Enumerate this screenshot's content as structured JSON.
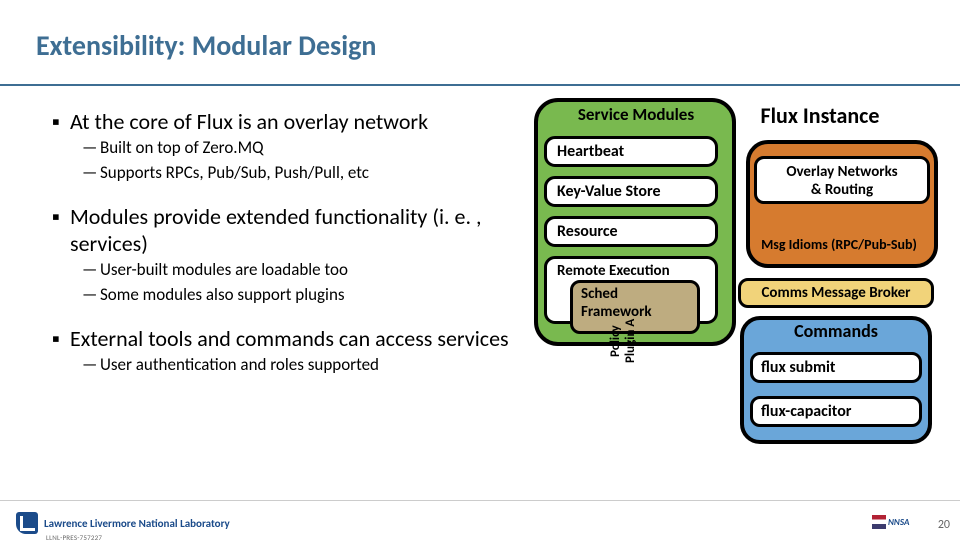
{
  "title": "Extensibility: Modular Design",
  "bullets": {
    "b1": {
      "text": "At the core of Flux is an overlay network",
      "subs": [
        "Built on top of Zero.MQ",
        "Supports RPCs, Pub/Sub, Push/Pull, etc"
      ]
    },
    "b2": {
      "text": "Modules provide extended functionality (i. e. , services)",
      "subs": [
        "User-built modules are loadable too",
        "Some modules also support plugins"
      ]
    },
    "b3": {
      "text": "External tools and commands can access services",
      "subs": [
        "User authentication and roles supported"
      ]
    }
  },
  "diagram": {
    "flux_instance": "Flux Instance",
    "service_modules": "Service Modules",
    "heartbeat": "Heartbeat",
    "kvstore": "Key-Value Store",
    "resource": "Resource",
    "remote_exec": "Remote Execution",
    "sched": "Sched\nFramework",
    "plugin": "Policy Plugin A",
    "overlay": "Overlay Networks\n& Routing",
    "msg_idioms": "Msg Idioms (RPC/Pub-Sub)",
    "broker": "Comms Message Broker",
    "commands": "Commands",
    "flux_submit": "flux submit",
    "flux_capacitor": "flux-capacitor"
  },
  "footer": {
    "org": "Lawrence Livermore National Laboratory",
    "pres_id": "LLNL-PRES-757227",
    "nnsa": "NNSA",
    "slide_no": "20"
  }
}
